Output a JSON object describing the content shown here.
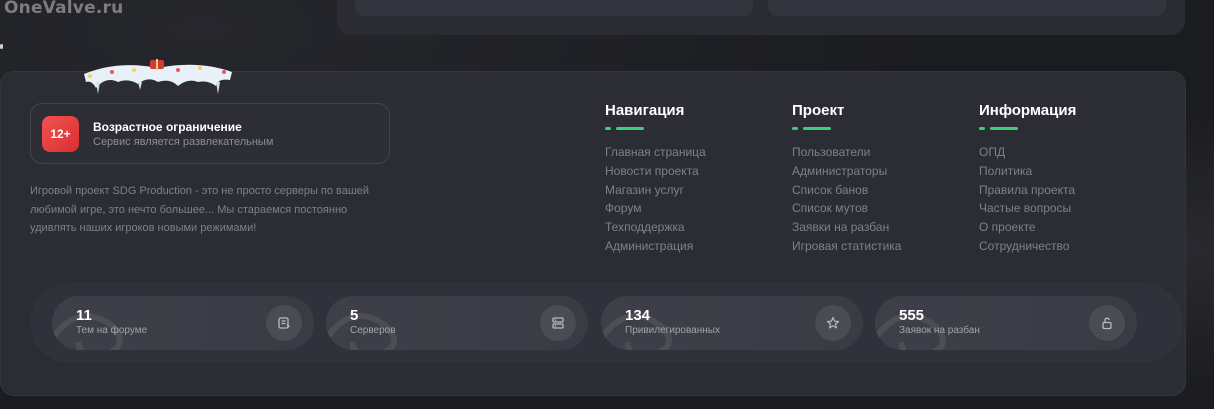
{
  "watermark": "OneValve.ru",
  "age": {
    "badge": "12+",
    "title": "Возрастное ограничение",
    "subtitle": "Сервис является развлекательным"
  },
  "about": "Игровой проект SDG Production - это не просто серверы по вашей любимой игре, это нечто большее... Мы стараемся постоянно удивлять наших игроков новыми режимами!",
  "columns": [
    {
      "title": "Навигация",
      "links": [
        "Главная страница",
        "Новости проекта",
        "Магазин услуг",
        "Форум",
        "Техподдержка",
        "Администрация"
      ]
    },
    {
      "title": "Проект",
      "links": [
        "Пользователи",
        "Администраторы",
        "Список банов",
        "Список мутов",
        "Заявки на разбан",
        "Игровая статистика"
      ]
    },
    {
      "title": "Информация",
      "links": [
        "ОПД",
        "Политика",
        "Правила проекта",
        "Частые вопросы",
        "О проекте",
        "Сотрудничество"
      ]
    }
  ],
  "stats": [
    {
      "value": "11",
      "label": "Тем на форуме",
      "icon": "forum-icon"
    },
    {
      "value": "5",
      "label": "Серверов",
      "icon": "server-icon"
    },
    {
      "value": "134",
      "label": "Привилегированных",
      "icon": "star-icon"
    },
    {
      "value": "555",
      "label": "Заявок на разбан",
      "icon": "unlock-icon"
    }
  ],
  "colors": {
    "accent": "#3ecf7c",
    "badge": "#e53e3e",
    "panel": "#2b2c34"
  }
}
